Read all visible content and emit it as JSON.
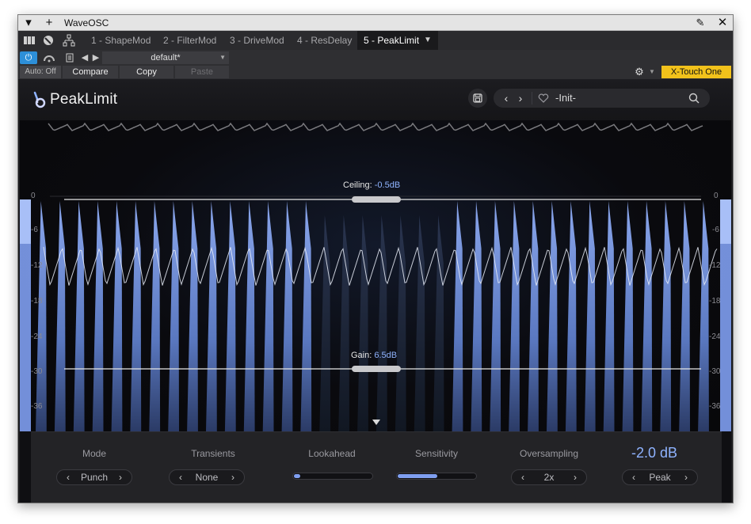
{
  "window": {
    "title": "WaveOSC"
  },
  "chain": {
    "tabs": [
      {
        "label": "1 - ShapeMod"
      },
      {
        "label": "2 - FilterMod"
      },
      {
        "label": "3 - DriveMod"
      },
      {
        "label": "4 - ResDelay"
      },
      {
        "label": "5 - PeakLimit"
      }
    ],
    "active_tab": 4
  },
  "controls": {
    "preset": "default*",
    "auto": "Auto: Off",
    "compare": "Compare",
    "copy": "Copy",
    "paste": "Paste",
    "controller": "X-Touch One"
  },
  "plugin": {
    "name": "PeakLimit",
    "preset_name": "-Init-",
    "ceiling": {
      "label": "Ceiling:",
      "value": "-0.5dB"
    },
    "gain": {
      "label": "Gain:",
      "value": "6.5dB"
    },
    "scale": {
      "labels": [
        "0",
        "-6",
        "-12",
        "-18",
        "-24",
        "-30",
        "-36"
      ]
    },
    "params": {
      "mode": {
        "label": "Mode",
        "value": "Punch"
      },
      "transients": {
        "label": "Transients",
        "value": "None"
      },
      "lookahead": {
        "label": "Lookahead",
        "level": 0.04
      },
      "sensitivity": {
        "label": "Sensitivity",
        "level": 0.5
      },
      "oversampling": {
        "label": "Oversampling",
        "value": "2x"
      },
      "output": {
        "value": "-2.0 dB",
        "mode": "Peak"
      }
    }
  },
  "colors": {
    "accent": "#8fb3ff",
    "waveform": "#6f8fd6",
    "controller": "#f2c21b",
    "power": "#2d8fd8"
  }
}
